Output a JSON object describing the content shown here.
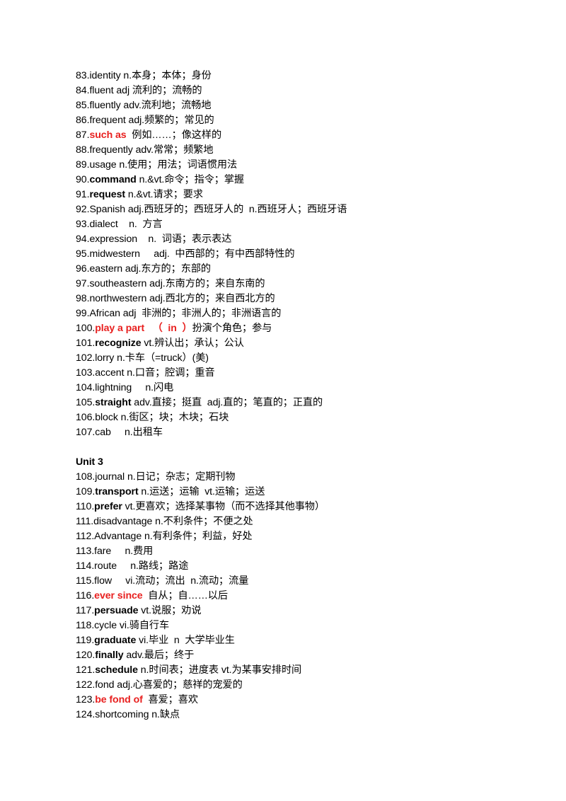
{
  "document": {
    "section1": [
      {
        "num": "83.",
        "term": "identity",
        "style": "normal",
        "def": " n.本身；本体；身份"
      },
      {
        "num": "84.",
        "term": "fluent",
        "style": "normal",
        "def": " adj 流利的；流畅的"
      },
      {
        "num": "85.",
        "term": "fluently",
        "style": "normal",
        "def": " adv.流利地；流畅地"
      },
      {
        "num": "86.",
        "term": "frequent",
        "style": "normal",
        "def": " adj.频繁的；常见的"
      },
      {
        "num": "87.",
        "term": "such as",
        "style": "red",
        "def": "  例如……；像这样的"
      },
      {
        "num": "88.",
        "term": "frequently",
        "style": "normal",
        "def": " adv.常常；频繁地"
      },
      {
        "num": "89.",
        "term": "usage",
        "style": "normal",
        "def": " n.使用；用法；词语惯用法"
      },
      {
        "num": "90.",
        "term": "command",
        "style": "bold",
        "def": " n.&vt.命令；指令；掌握"
      },
      {
        "num": "91.",
        "term": "request",
        "style": "bold",
        "def": " n.&vt.请求；要求"
      },
      {
        "num": "92.",
        "term": "Spanish",
        "style": "normal",
        "def": " adj.西班牙的；西班牙人的  n.西班牙人；西班牙语"
      },
      {
        "num": "93.",
        "term": "dialect",
        "style": "normal",
        "def": "    n.  方言"
      },
      {
        "num": "94.",
        "term": "expression",
        "style": "normal",
        "def": "    n.  词语；表示表达"
      },
      {
        "num": "95.",
        "term": "midwestern",
        "style": "normal",
        "def": "     adj.  中西部的；有中西部特性的"
      },
      {
        "num": "96.",
        "term": "eastern",
        "style": "normal",
        "def": " adj.东方的；东部的"
      },
      {
        "num": "97.",
        "term": "southeastern",
        "style": "normal",
        "def": " adj.东南方的；来自东南的"
      },
      {
        "num": "98.",
        "term": "northwestern",
        "style": "normal",
        "def": " adj.西北方的；来自西北方的"
      },
      {
        "num": "99.",
        "term": "African",
        "style": "normal",
        "def": " adj  非洲的；非洲人的；非洲语言的"
      },
      {
        "num": "100.",
        "term": "play a part   （  in  ）",
        "style": "red",
        "def": "扮演个角色；参与"
      },
      {
        "num": "101.",
        "term": "recognize",
        "style": "bold",
        "def": " vt.辨认出；承认；公认"
      },
      {
        "num": "102.",
        "term": "lorry",
        "style": "normal",
        "def": " n.卡车（=truck）(美)"
      },
      {
        "num": "103.",
        "term": "accent",
        "style": "normal",
        "def": " n.口音；腔调；重音"
      },
      {
        "num": "104.",
        "term": "lightning",
        "style": "normal",
        "def": "     n.闪电"
      },
      {
        "num": "105.",
        "term": "straight",
        "style": "bold",
        "def": " adv.直接；挺直  adj.直的；笔直的；正直的"
      },
      {
        "num": "106.",
        "term": "block",
        "style": "normal",
        "def": " n.街区；块；木块；石块"
      },
      {
        "num": "107.",
        "term": "cab",
        "style": "normal",
        "def": "     n.出租车"
      }
    ],
    "unit_heading": "Unit 3",
    "section2": [
      {
        "num": "108.",
        "term": "journal",
        "style": "normal",
        "def": " n.日记；杂志；定期刊物"
      },
      {
        "num": "109.",
        "term": "transport",
        "style": "bold",
        "def": " n.运送；运输  vt.运输；运送"
      },
      {
        "num": "110.",
        "term": "prefer",
        "style": "bold",
        "def": " vt.更喜欢；选择某事物（而不选择其他事物）"
      },
      {
        "num": "111.",
        "term": "disadvantage",
        "style": "normal",
        "def": " n.不利条件；不便之处"
      },
      {
        "num": "112.",
        "term": "Advantage",
        "style": "normal",
        "def": " n.有利条件；利益，好处"
      },
      {
        "num": "113.",
        "term": "fare",
        "style": "normal",
        "def": "     n.费用"
      },
      {
        "num": "114.",
        "term": "route",
        "style": "normal",
        "def": "     n.路线；路途"
      },
      {
        "num": "115.",
        "term": "flow",
        "style": "normal",
        "def": "     vi.流动；流出  n.流动；流量"
      },
      {
        "num": "116.",
        "term": "ever since",
        "style": "red",
        "def": "  自从；自……以后"
      },
      {
        "num": "117.",
        "term": "persuade",
        "style": "bold",
        "def": " vt.说服；劝说"
      },
      {
        "num": "118.",
        "term": "cycle",
        "style": "normal",
        "def": " vi.骑自行车"
      },
      {
        "num": "119.",
        "term": "graduate",
        "style": "bold",
        "def": " vi.毕业  n  大学毕业生"
      },
      {
        "num": "120.",
        "term": "finally",
        "style": "bold",
        "def": " adv.最后；终于"
      },
      {
        "num": "121.",
        "term": "schedule",
        "style": "bold",
        "def": " n.时间表；进度表 vt.为某事安排时间"
      },
      {
        "num": "122.",
        "term": "fond",
        "style": "normal",
        "def": " adj.心喜爱的；慈祥的宠爱的"
      },
      {
        "num": "123.",
        "term": "be fond of",
        "style": "red",
        "def": "  喜爱；喜欢"
      },
      {
        "num": "124.",
        "term": "shortcoming",
        "style": "normal",
        "def": " n.缺点"
      }
    ]
  },
  "colors": {
    "text": "#000000",
    "highlight_red": "#e8201f",
    "background": "#ffffff"
  }
}
